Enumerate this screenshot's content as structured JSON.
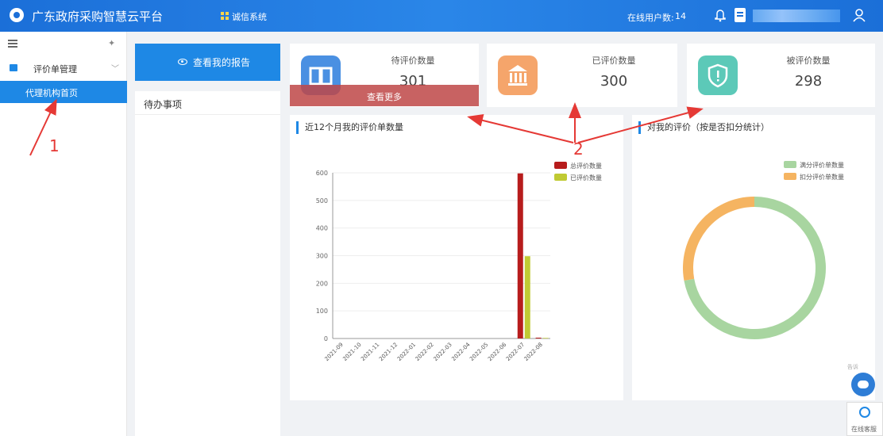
{
  "header": {
    "app_title": "广东政府采购智慧云平台",
    "system_link": "诚信系统",
    "online_label": "在线用户数:",
    "online_count": "14"
  },
  "sidebar": {
    "group_label": "评价单管理",
    "active_item": "代理机构首页"
  },
  "left": {
    "report_button": "查看我的报告",
    "todo_title": "待办事项"
  },
  "cards": [
    {
      "label": "待评价数量",
      "value": "301",
      "more": "查看更多",
      "color": "#4a90e2"
    },
    {
      "label": "已评价数量",
      "value": "300",
      "color": "#f5a56b"
    },
    {
      "label": "被评价数量",
      "value": "298",
      "color": "#5cc9b8"
    }
  ],
  "bar_panel": {
    "title": "近12个月我的评价单数量"
  },
  "donut_panel": {
    "title": "对我的评价（按是否扣分统计）"
  },
  "annotations": [
    "1",
    "2"
  ],
  "floating": {
    "robot_tag": "告诉",
    "service_label": "在线客服"
  },
  "chart_data": [
    {
      "type": "bar",
      "categories": [
        "2021-09",
        "2021-10",
        "2021-11",
        "2021-12",
        "2022-01",
        "2022-02",
        "2022-03",
        "2022-04",
        "2022-05",
        "2022-06",
        "2022-07",
        "2022-08"
      ],
      "series": [
        {
          "name": "总评价数量",
          "color": "#b71c1c",
          "values": [
            0,
            0,
            0,
            0,
            0,
            0,
            0,
            0,
            0,
            0,
            598,
            3
          ]
        },
        {
          "name": "已评价数量",
          "color": "#c0ca33",
          "values": [
            0,
            0,
            0,
            0,
            0,
            0,
            0,
            0,
            0,
            0,
            298,
            2
          ]
        }
      ],
      "ylim": [
        0,
        600
      ],
      "yticks": [
        0,
        100,
        200,
        300,
        400,
        500,
        600
      ],
      "legend": "top-right"
    },
    {
      "type": "pie",
      "series": [
        {
          "name": "满分评价单数量",
          "color": "#a8d5a0",
          "value": 215
        },
        {
          "name": "扣分评价单数量",
          "color": "#f5b461",
          "value": 83
        }
      ],
      "legend": "top-right"
    }
  ]
}
